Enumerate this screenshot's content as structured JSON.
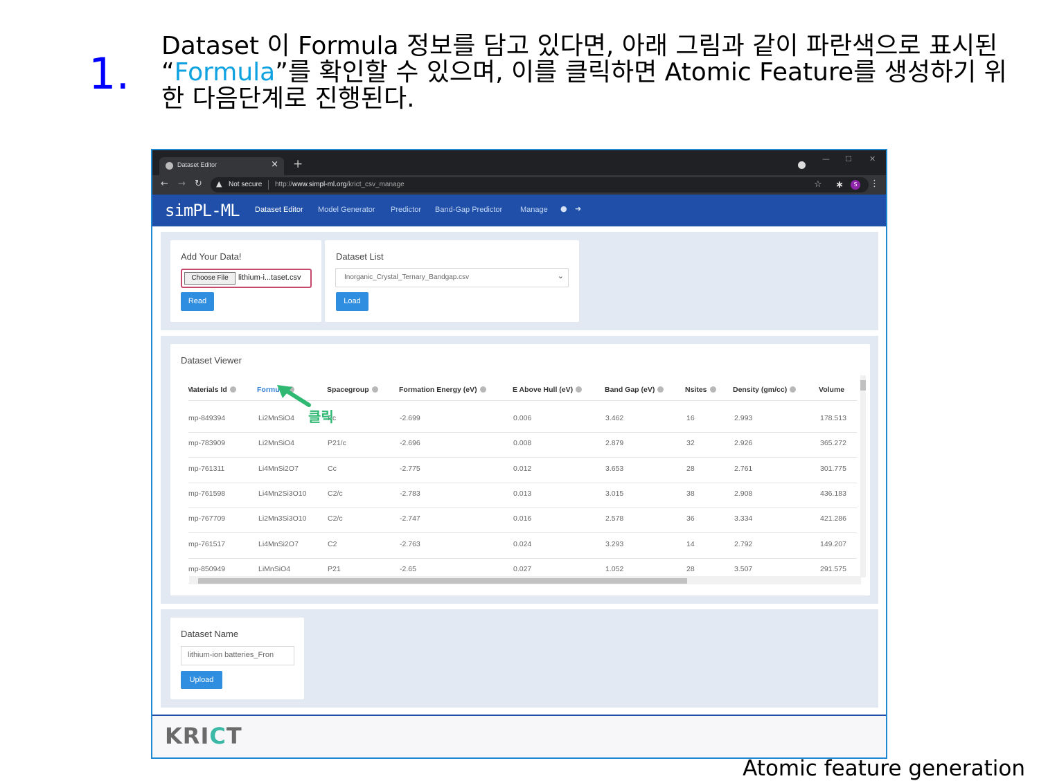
{
  "slide": {
    "step_number": "1.",
    "heading_before": "Dataset 이 Formula 정보를 담고 있다면, 아래 그림과 같이 파란색으로 표시된 “",
    "heading_highlight": "Formula",
    "heading_after": "”를 확인할 수 있으며, 이를 클릭하면 Atomic Feature를 생성하기 위한 다음단계로 진행된다.",
    "caption": "Atomic feature generation",
    "click_label": "클릭"
  },
  "browser": {
    "tab_title": "Dataset Editor",
    "new_tab": "+",
    "tab_close": "×",
    "security": "Not secure",
    "url_prefix": "http://",
    "url_host": "www.simpl-ml.org",
    "url_path": "/krict_csv_manage",
    "avatar_letter": "S",
    "minimize": "—",
    "maximize": "☐",
    "close": "✕"
  },
  "navbar": {
    "brand": "simPL-ML",
    "links": [
      "Dataset Editor",
      "Model Generator",
      "Predictor",
      "Band-Gap Predictor",
      "Manage"
    ]
  },
  "add_data": {
    "title": "Add Your Data!",
    "choose_file": "Choose File",
    "file_name": "lithium-i...taset.csv",
    "read_button": "Read"
  },
  "dataset_list": {
    "title": "Dataset List",
    "selected": "Inorganic_Crystal_Ternary_Bandgap.csv",
    "load_button": "Load"
  },
  "viewer": {
    "title": "Dataset Viewer",
    "columns": [
      "Materials Id",
      "Formula",
      "Spacegroup",
      "Formation Energy (eV)",
      "E Above Hull (eV)",
      "Band Gap (eV)",
      "Nsites",
      "Density (gm/cc)",
      "Volume"
    ],
    "rows": [
      [
        "mp-849394",
        "Li2MnSiO4",
        "Pc",
        "-2.699",
        "0.006",
        "3.462",
        "16",
        "2.993",
        "178.513"
      ],
      [
        "mp-783909",
        "Li2MnSiO4",
        "P21/c",
        "-2.696",
        "0.008",
        "2.879",
        "32",
        "2.926",
        "365.272"
      ],
      [
        "mp-761311",
        "Li4MnSi2O7",
        "Cc",
        "-2.775",
        "0.012",
        "3.653",
        "28",
        "2.761",
        "301.775"
      ],
      [
        "mp-761598",
        "Li4Mn2Si3O10",
        "C2/c",
        "-2.783",
        "0.013",
        "3.015",
        "38",
        "2.908",
        "436.183"
      ],
      [
        "mp-767709",
        "Li2Mn3Si3O10",
        "C2/c",
        "-2.747",
        "0.016",
        "2.578",
        "36",
        "3.334",
        "421.286"
      ],
      [
        "mp-761517",
        "Li4MnSi2O7",
        "C2",
        "-2.763",
        "0.024",
        "3.293",
        "14",
        "2.792",
        "149.207"
      ],
      [
        "mp-850949",
        "LiMnSiO4",
        "P21",
        "-2.65",
        "0.027",
        "1.052",
        "28",
        "3.507",
        "291.575"
      ]
    ]
  },
  "dataset_name": {
    "title": "Dataset Name",
    "value": "lithium-ion batteries_Fron",
    "upload_button": "Upload"
  },
  "footer": {
    "logo_prefix": "KRI",
    "logo_accent": "C",
    "logo_suffix": "T"
  },
  "colors": {
    "navbar": "#1f4fa8",
    "button": "#2f8ee0",
    "highlight": "#0fa2e0",
    "click_annotation": "#2eb872",
    "step_number": "#0000ff"
  }
}
